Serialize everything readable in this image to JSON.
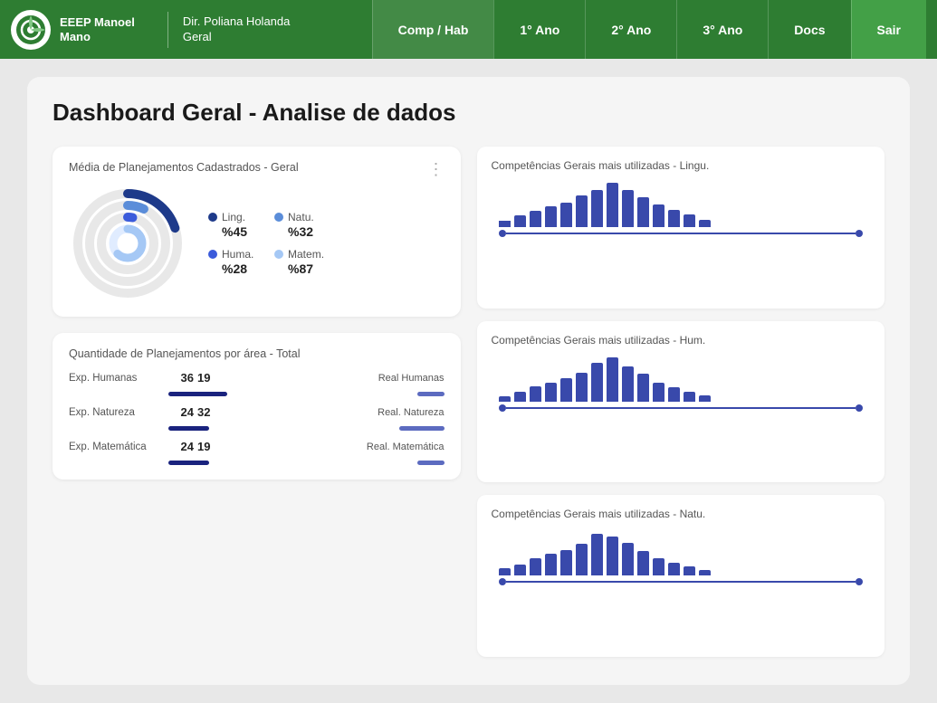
{
  "header": {
    "school_name_line1": "EEEP Manoel",
    "school_name_line2": "Mano",
    "director": "Dir. Poliana Holanda",
    "director_role": "Geral",
    "nav": [
      {
        "label": "Comp / Hab",
        "id": "comp-hab",
        "active": true
      },
      {
        "label": "1° Ano",
        "id": "ano1"
      },
      {
        "label": "2° Ano",
        "id": "ano2"
      },
      {
        "label": "3° Ano",
        "id": "ano3"
      },
      {
        "label": "Docs",
        "id": "docs"
      },
      {
        "label": "Sair",
        "id": "sair",
        "special": true
      }
    ]
  },
  "page": {
    "title": "Dashboard Geral - Analise de dados"
  },
  "donut_widget": {
    "title": "Média de Planejamentos Cadastrados - Geral",
    "menu_icon": "⋮",
    "legend": [
      {
        "label": "Ling.",
        "value": "%45",
        "color": "#1e3a8a"
      },
      {
        "label": "Natu.",
        "value": "%32",
        "color": "#5b8dd9"
      },
      {
        "label": "Huma.",
        "value": "%28",
        "color": "#3b5bdb"
      },
      {
        "label": "Matem.",
        "value": "%87",
        "color": "#a5c8f5"
      }
    ],
    "rings": [
      {
        "r": 55,
        "pct": 0.45,
        "color": "#1e3a8a",
        "stroke": 10
      },
      {
        "r": 42,
        "pct": 0.32,
        "color": "#5b8dd9",
        "stroke": 10
      },
      {
        "r": 29,
        "pct": 0.28,
        "color": "#3b5bdb",
        "stroke": 10
      },
      {
        "r": 16,
        "pct": 0.87,
        "color": "#a5c8f5",
        "stroke": 10
      }
    ]
  },
  "qty_widget": {
    "title": "Quantidade de Planejamentos por área - Total",
    "rows": [
      {
        "label_left": "Exp. Humanas",
        "num_left": "36",
        "num_right": "19",
        "label_right": "Real Humanas",
        "bar_left_w": 65,
        "bar_right_w": 30
      },
      {
        "label_left": "Exp. Natureza",
        "num_left": "24",
        "num_right": "32",
        "label_right": "Real. Natureza",
        "bar_left_w": 45,
        "bar_right_w": 50
      },
      {
        "label_left": "Exp. Matemática",
        "num_left": "24",
        "num_right": "19",
        "label_right": "Real. Matemática",
        "bar_left_w": 45,
        "bar_right_w": 30
      }
    ]
  },
  "comp_charts": [
    {
      "title": "Competências Gerais mais utilizadas - Lingu.",
      "bars": [
        12,
        22,
        30,
        38,
        45,
        52,
        55,
        58,
        48,
        40,
        35,
        28,
        22,
        15
      ]
    },
    {
      "title": "Competências Gerais mais utilizadas - Hum.",
      "bars": [
        10,
        18,
        28,
        35,
        42,
        50,
        55,
        52,
        45,
        38,
        32,
        25,
        18,
        12
      ]
    },
    {
      "title": "Competências Gerais mais utilizadas - Natu.",
      "bars": [
        14,
        20,
        32,
        40,
        48,
        54,
        58,
        52,
        44,
        36,
        30,
        22,
        16,
        10
      ]
    }
  ],
  "colors": {
    "header_bg": "#2e7d32",
    "nav_active": "#388e3c",
    "sair_bg": "#43a047",
    "bar_dark": "#1e3a8a",
    "bar_mid": "#3949ab",
    "accent": "#5c6bc0"
  }
}
